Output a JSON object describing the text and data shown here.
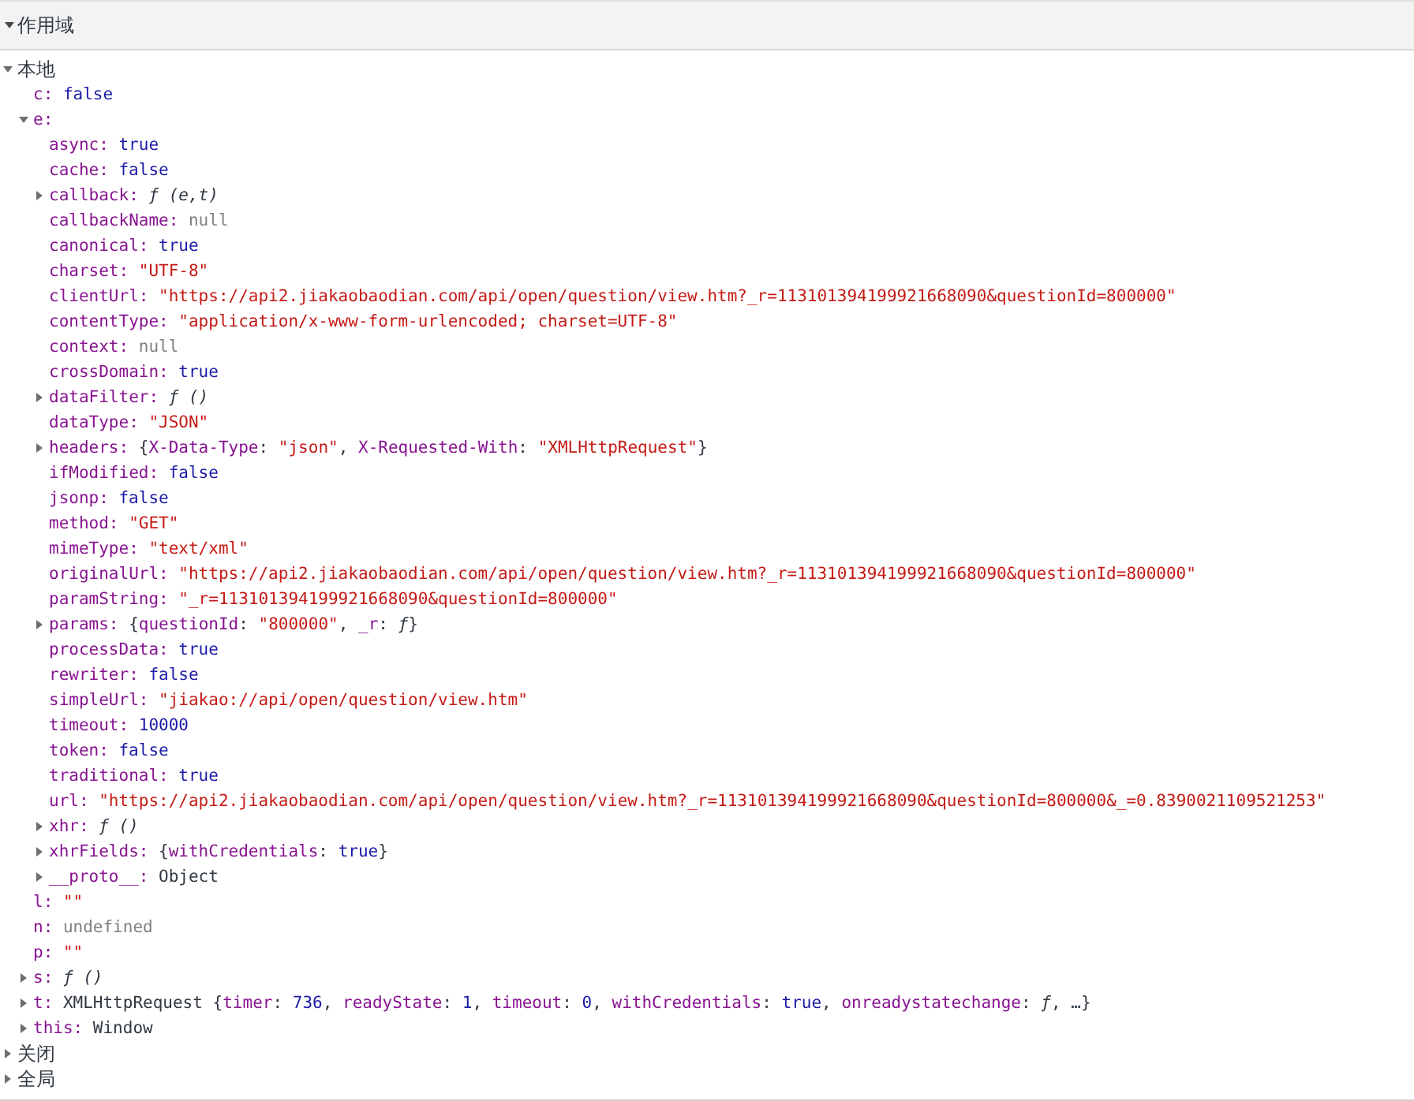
{
  "section": {
    "title": "作用域",
    "expanded": true
  },
  "scopes": [
    {
      "label": "本地",
      "expanded": true,
      "children": [
        {
          "name": "c:",
          "value": "false",
          "kind": "boolean"
        },
        {
          "name": "e:",
          "expanded": true,
          "children": [
            {
              "name": "async:",
              "value": "true",
              "kind": "boolean"
            },
            {
              "name": "cache:",
              "value": "false",
              "kind": "boolean"
            },
            {
              "name": "callback:",
              "value": "ƒ (e,t)",
              "kind": "function",
              "expanded": false
            },
            {
              "name": "callbackName:",
              "value": "null",
              "kind": "null"
            },
            {
              "name": "canonical:",
              "value": "true",
              "kind": "boolean"
            },
            {
              "name": "charset:",
              "value": "\"UTF-8\"",
              "kind": "string"
            },
            {
              "name": "clientUrl:",
              "value": "\"https://api2.jiakaobaodian.com/api/open/question/view.htm?_r=113101394199921668090&questionId=800000\"",
              "kind": "string"
            },
            {
              "name": "contentType:",
              "value": "\"application/x-www-form-urlencoded; charset=UTF-8\"",
              "kind": "string"
            },
            {
              "name": "context:",
              "value": "null",
              "kind": "null"
            },
            {
              "name": "crossDomain:",
              "value": "true",
              "kind": "boolean"
            },
            {
              "name": "dataFilter:",
              "value": "ƒ ()",
              "kind": "function",
              "expanded": false
            },
            {
              "name": "dataType:",
              "value": "\"JSON\"",
              "kind": "string"
            },
            {
              "name": "headers:",
              "kind": "preview",
              "expanded": false,
              "parts": [
                {
                  "text": "{",
                  "kind": "plain"
                },
                {
                  "text": "X-Data-Type",
                  "kind": "key"
                },
                {
                  "text": ": ",
                  "kind": "plain"
                },
                {
                  "text": "\"json\"",
                  "kind": "string"
                },
                {
                  "text": ", ",
                  "kind": "plain"
                },
                {
                  "text": "X-Requested-With",
                  "kind": "key"
                },
                {
                  "text": ": ",
                  "kind": "plain"
                },
                {
                  "text": "\"XMLHttpRequest\"",
                  "kind": "string"
                },
                {
                  "text": "}",
                  "kind": "plain"
                }
              ]
            },
            {
              "name": "ifModified:",
              "value": "false",
              "kind": "boolean"
            },
            {
              "name": "jsonp:",
              "value": "false",
              "kind": "boolean"
            },
            {
              "name": "method:",
              "value": "\"GET\"",
              "kind": "string"
            },
            {
              "name": "mimeType:",
              "value": "\"text/xml\"",
              "kind": "string"
            },
            {
              "name": "originalUrl:",
              "value": "\"https://api2.jiakaobaodian.com/api/open/question/view.htm?_r=113101394199921668090&questionId=800000\"",
              "kind": "string"
            },
            {
              "name": "paramString:",
              "value": "\"_r=113101394199921668090&questionId=800000\"",
              "kind": "string"
            },
            {
              "name": "params:",
              "kind": "preview",
              "expanded": false,
              "parts": [
                {
                  "text": "{",
                  "kind": "plain"
                },
                {
                  "text": "questionId",
                  "kind": "key"
                },
                {
                  "text": ": ",
                  "kind": "plain"
                },
                {
                  "text": "\"800000\"",
                  "kind": "string"
                },
                {
                  "text": ", ",
                  "kind": "plain"
                },
                {
                  "text": "_r",
                  "kind": "key"
                },
                {
                  "text": ": ",
                  "kind": "plain"
                },
                {
                  "text": "ƒ",
                  "kind": "function"
                },
                {
                  "text": "}",
                  "kind": "plain"
                }
              ]
            },
            {
              "name": "processData:",
              "value": "true",
              "kind": "boolean"
            },
            {
              "name": "rewriter:",
              "value": "false",
              "kind": "boolean"
            },
            {
              "name": "simpleUrl:",
              "value": "\"jiakao://api/open/question/view.htm\"",
              "kind": "string"
            },
            {
              "name": "timeout:",
              "value": "10000",
              "kind": "number"
            },
            {
              "name": "token:",
              "value": "false",
              "kind": "boolean"
            },
            {
              "name": "traditional:",
              "value": "true",
              "kind": "boolean"
            },
            {
              "name": "url:",
              "value": "\"https://api2.jiakaobaodian.com/api/open/question/view.htm?_r=113101394199921668090&questionId=800000&_=0.8390021109521253\"",
              "kind": "string"
            },
            {
              "name": "xhr:",
              "value": "ƒ ()",
              "kind": "function",
              "expanded": false
            },
            {
              "name": "xhrFields:",
              "kind": "preview",
              "expanded": false,
              "parts": [
                {
                  "text": "{",
                  "kind": "plain"
                },
                {
                  "text": "withCredentials",
                  "kind": "key"
                },
                {
                  "text": ": ",
                  "kind": "plain"
                },
                {
                  "text": "true",
                  "kind": "boolean"
                },
                {
                  "text": "}",
                  "kind": "plain"
                }
              ]
            },
            {
              "name": "__proto__:",
              "value": "Object",
              "kind": "object",
              "expanded": false
            }
          ]
        },
        {
          "name": "l:",
          "value": "\"\"",
          "kind": "string"
        },
        {
          "name": "n:",
          "value": "undefined",
          "kind": "null"
        },
        {
          "name": "p:",
          "value": "\"\"",
          "kind": "string"
        },
        {
          "name": "s:",
          "value": "ƒ ()",
          "kind": "function",
          "expanded": false
        },
        {
          "name": "t:",
          "kind": "preview",
          "expanded": false,
          "parts": [
            {
              "text": "XMLHttpRequest {",
              "kind": "plain"
            },
            {
              "text": "timer",
              "kind": "key"
            },
            {
              "text": ": ",
              "kind": "plain"
            },
            {
              "text": "736",
              "kind": "number"
            },
            {
              "text": ", ",
              "kind": "plain"
            },
            {
              "text": "readyState",
              "kind": "key"
            },
            {
              "text": ": ",
              "kind": "plain"
            },
            {
              "text": "1",
              "kind": "number"
            },
            {
              "text": ", ",
              "kind": "plain"
            },
            {
              "text": "timeout",
              "kind": "key"
            },
            {
              "text": ": ",
              "kind": "plain"
            },
            {
              "text": "0",
              "kind": "number"
            },
            {
              "text": ", ",
              "kind": "plain"
            },
            {
              "text": "withCredentials",
              "kind": "key"
            },
            {
              "text": ": ",
              "kind": "plain"
            },
            {
              "text": "true",
              "kind": "boolean"
            },
            {
              "text": ", ",
              "kind": "plain"
            },
            {
              "text": "onreadystatechange",
              "kind": "key"
            },
            {
              "text": ": ",
              "kind": "plain"
            },
            {
              "text": "ƒ",
              "kind": "function"
            },
            {
              "text": ", …}",
              "kind": "plain"
            }
          ]
        },
        {
          "name": "this:",
          "value": "Window",
          "kind": "object",
          "expanded": false
        }
      ]
    },
    {
      "label": "关闭",
      "expanded": false
    },
    {
      "label": "全局",
      "expanded": false
    }
  ]
}
